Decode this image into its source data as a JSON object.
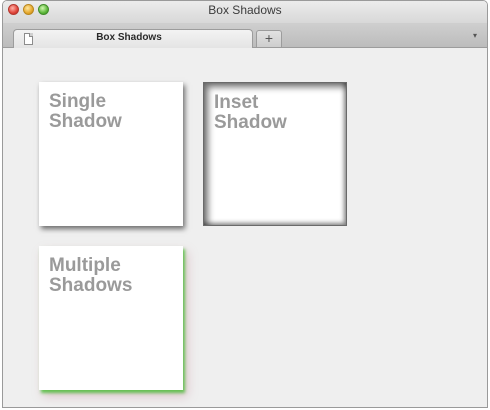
{
  "window": {
    "title": "Box Shadows",
    "buttons": [
      "close",
      "minimize",
      "zoom"
    ]
  },
  "tabs": [
    {
      "label": "Box Shadows",
      "icon": "document-icon",
      "active": true
    }
  ],
  "new_tab_label": "+",
  "tab_menu_icon": "▾",
  "boxes": [
    {
      "label": "Single\nShadow",
      "shadow": "single"
    },
    {
      "label": "Inset\nShadow",
      "shadow": "inset"
    },
    {
      "label": "Multiple\nShadows",
      "shadow": "multiple"
    }
  ],
  "colors": {
    "page_background": "#efefef",
    "box_background": "#ffffff",
    "label_text": "#9a9a9a",
    "multiple_shadow_green": "#50be3c"
  }
}
